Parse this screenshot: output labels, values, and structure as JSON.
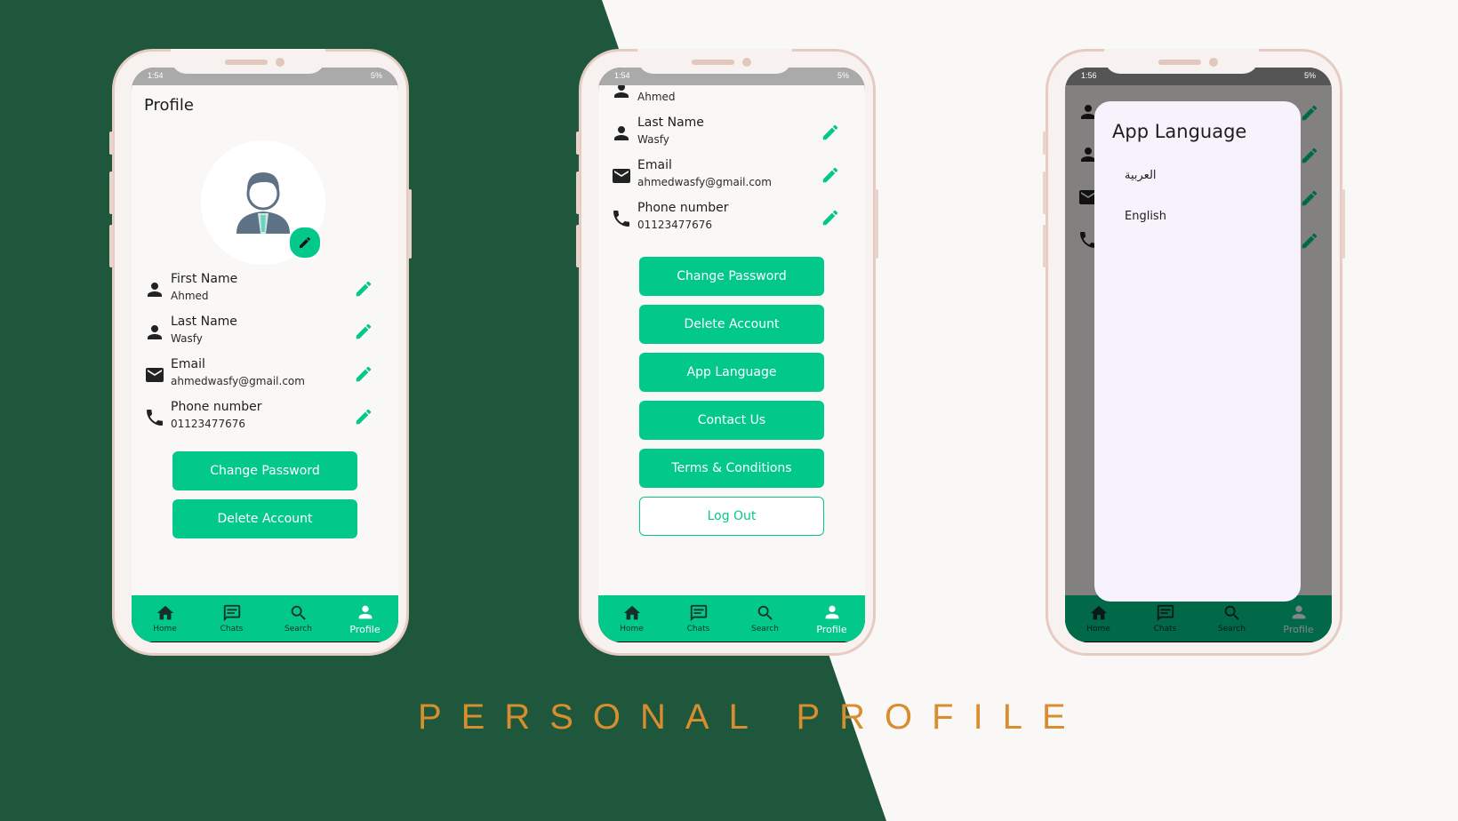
{
  "banner": {
    "headline": "PERSONAL PROFILE"
  },
  "colors": {
    "dark_green": "#1e573c",
    "accent": "#02c98a",
    "background": "#faf8f6",
    "headline": "#d88e2e"
  },
  "phone1": {
    "status": {
      "time": "1:54",
      "battery": "5%"
    },
    "title": "Profile",
    "fields": [
      {
        "label": "First Name",
        "value": "Ahmed",
        "icon": "person-icon"
      },
      {
        "label": "Last Name",
        "value": "Wasfy",
        "icon": "person-icon"
      },
      {
        "label": "Email",
        "value": "ahmedwasfy@gmail.com",
        "icon": "mail-icon"
      },
      {
        "label": "Phone number",
        "value": "01123477676",
        "icon": "phone-icon"
      }
    ],
    "buttons": [
      "Change Password",
      "Delete Account"
    ]
  },
  "phone2": {
    "status": {
      "time": "1:54",
      "battery": "5%"
    },
    "partial_value": "Ahmed",
    "fields": [
      {
        "label": "Last Name",
        "value": "Wasfy",
        "icon": "person-icon"
      },
      {
        "label": "Email",
        "value": "ahmedwasfy@gmail.com",
        "icon": "mail-icon"
      },
      {
        "label": "Phone number",
        "value": "01123477676",
        "icon": "phone-icon"
      }
    ],
    "buttons": [
      "Change Password",
      "Delete Account",
      "App Language",
      "Contact Us",
      "Terms & Conditions"
    ],
    "logout": "Log Out"
  },
  "phone3": {
    "status": {
      "time": "1:56",
      "battery": "5%"
    },
    "dialog": {
      "title": "App Language",
      "options": [
        "العربية",
        "English"
      ]
    }
  },
  "nav": {
    "items": [
      "Home",
      "Chats",
      "Search",
      "Profile"
    ],
    "active": "Profile"
  }
}
